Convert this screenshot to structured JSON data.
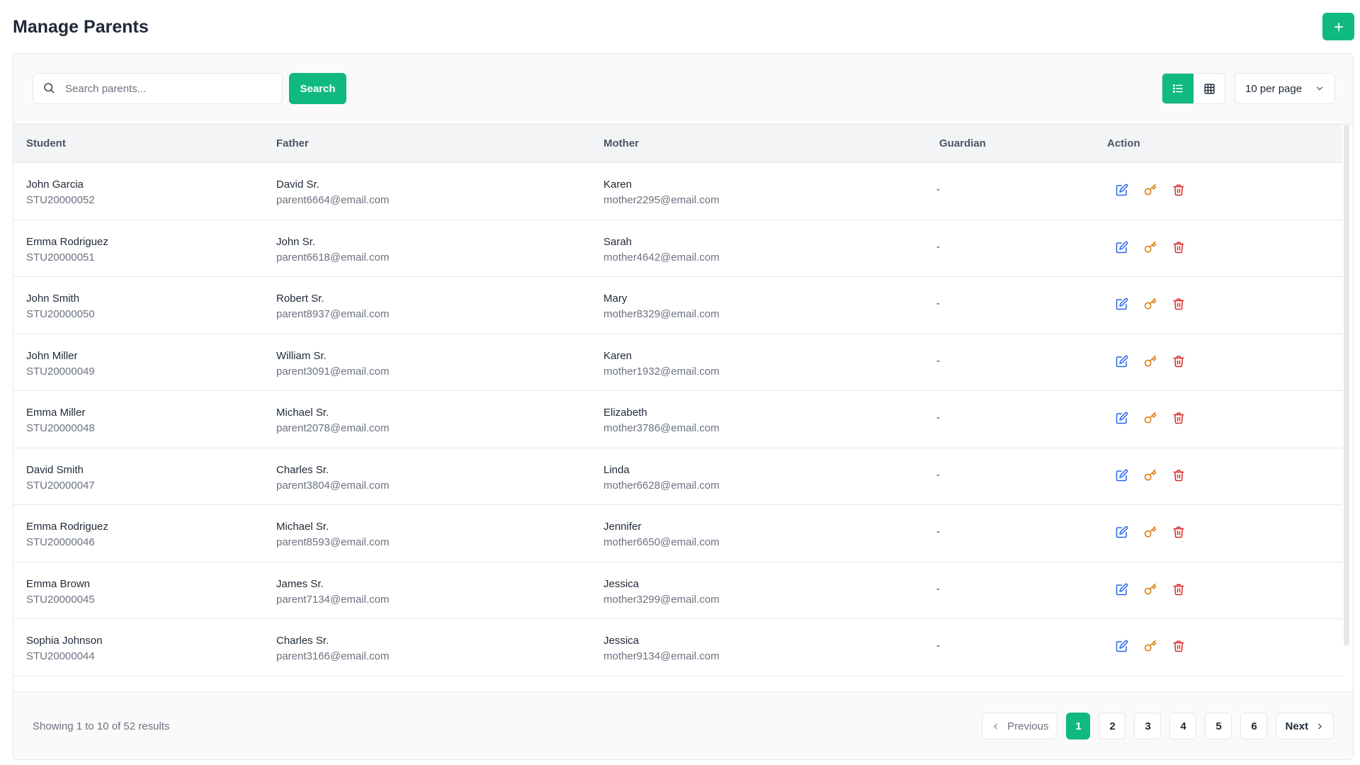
{
  "page": {
    "title": "Manage Parents"
  },
  "colors": {
    "accent": "#10b981",
    "edit_icon": "#2563eb",
    "key_icon": "#d97706",
    "delete_icon": "#dc2626"
  },
  "toolbar": {
    "search_placeholder": "Search parents...",
    "search_value": "",
    "search_button": "Search",
    "per_page": "10 per page",
    "icons": {
      "search": "search-icon",
      "list_view": "list-icon",
      "grid_view": "grid-icon",
      "dropdown": "chevron-down-icon",
      "add": "plus-icon"
    }
  },
  "table": {
    "columns": [
      "Student",
      "Father",
      "Mother",
      "Guardian",
      "Action"
    ],
    "rows": [
      {
        "student_name": "John Garcia",
        "student_id": "STU20000052",
        "father_name": "David Sr.",
        "father_email": "parent6664@email.com",
        "mother_name": "Karen",
        "mother_email": "mother2295@email.com",
        "guardian": "-"
      },
      {
        "student_name": "Emma Rodriguez",
        "student_id": "STU20000051",
        "father_name": "John Sr.",
        "father_email": "parent6618@email.com",
        "mother_name": "Sarah",
        "mother_email": "mother4642@email.com",
        "guardian": "-"
      },
      {
        "student_name": "John Smith",
        "student_id": "STU20000050",
        "father_name": "Robert Sr.",
        "father_email": "parent8937@email.com",
        "mother_name": "Mary",
        "mother_email": "mother8329@email.com",
        "guardian": "-"
      },
      {
        "student_name": "John Miller",
        "student_id": "STU20000049",
        "father_name": "William Sr.",
        "father_email": "parent3091@email.com",
        "mother_name": "Karen",
        "mother_email": "mother1932@email.com",
        "guardian": "-"
      },
      {
        "student_name": "Emma Miller",
        "student_id": "STU20000048",
        "father_name": "Michael Sr.",
        "father_email": "parent2078@email.com",
        "mother_name": "Elizabeth",
        "mother_email": "mother3786@email.com",
        "guardian": "-"
      },
      {
        "student_name": "David Smith",
        "student_id": "STU20000047",
        "father_name": "Charles Sr.",
        "father_email": "parent3804@email.com",
        "mother_name": "Linda",
        "mother_email": "mother6628@email.com",
        "guardian": "-"
      },
      {
        "student_name": "Emma Rodriguez",
        "student_id": "STU20000046",
        "father_name": "Michael Sr.",
        "father_email": "parent8593@email.com",
        "mother_name": "Jennifer",
        "mother_email": "mother6650@email.com",
        "guardian": "-"
      },
      {
        "student_name": "Emma Brown",
        "student_id": "STU20000045",
        "father_name": "James Sr.",
        "father_email": "parent7134@email.com",
        "mother_name": "Jessica",
        "mother_email": "mother3299@email.com",
        "guardian": "-"
      },
      {
        "student_name": "Sophia Johnson",
        "student_id": "STU20000044",
        "father_name": "Charles Sr.",
        "father_email": "parent3166@email.com",
        "mother_name": "Jessica",
        "mother_email": "mother9134@email.com",
        "guardian": "-"
      }
    ],
    "row_action_icons": [
      "edit-icon",
      "key-icon",
      "trash-icon"
    ]
  },
  "footer": {
    "showing": "Showing 1 to 10 of 52 results",
    "previous": "Previous",
    "next": "Next",
    "pages": [
      "1",
      "2",
      "3",
      "4",
      "5",
      "6"
    ],
    "current_page": "1"
  }
}
